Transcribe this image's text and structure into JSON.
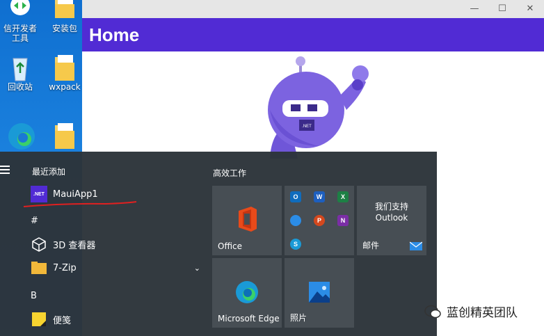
{
  "desktop": {
    "icons": [
      {
        "label": "信开发者工具"
      },
      {
        "label": "安装包"
      },
      {
        "label": "回收站"
      },
      {
        "label": "wxpack"
      }
    ]
  },
  "window": {
    "controls": {
      "minimize": "—",
      "maximize": "☐",
      "close": "✕"
    },
    "header_title": "Home",
    "accent_color": "#512bd4"
  },
  "start_menu": {
    "recent_heading": "最近添加",
    "apps": [
      {
        "label": "MauiApp1",
        "icon_text": ".NET"
      },
      {
        "label": "3D 查看器"
      },
      {
        "label": "7-Zip"
      },
      {
        "label": "便笺"
      }
    ],
    "letters": {
      "hash": "#",
      "b": "B"
    },
    "tiles_heading": "高效工作",
    "tiles": {
      "office": "Office",
      "outlook_line1": "我们支持",
      "outlook_line2": "Outlook",
      "mail": "邮件",
      "edge": "Microsoft Edge",
      "photos": "照片"
    }
  },
  "watermark": {
    "text": "蓝创精英团队"
  }
}
